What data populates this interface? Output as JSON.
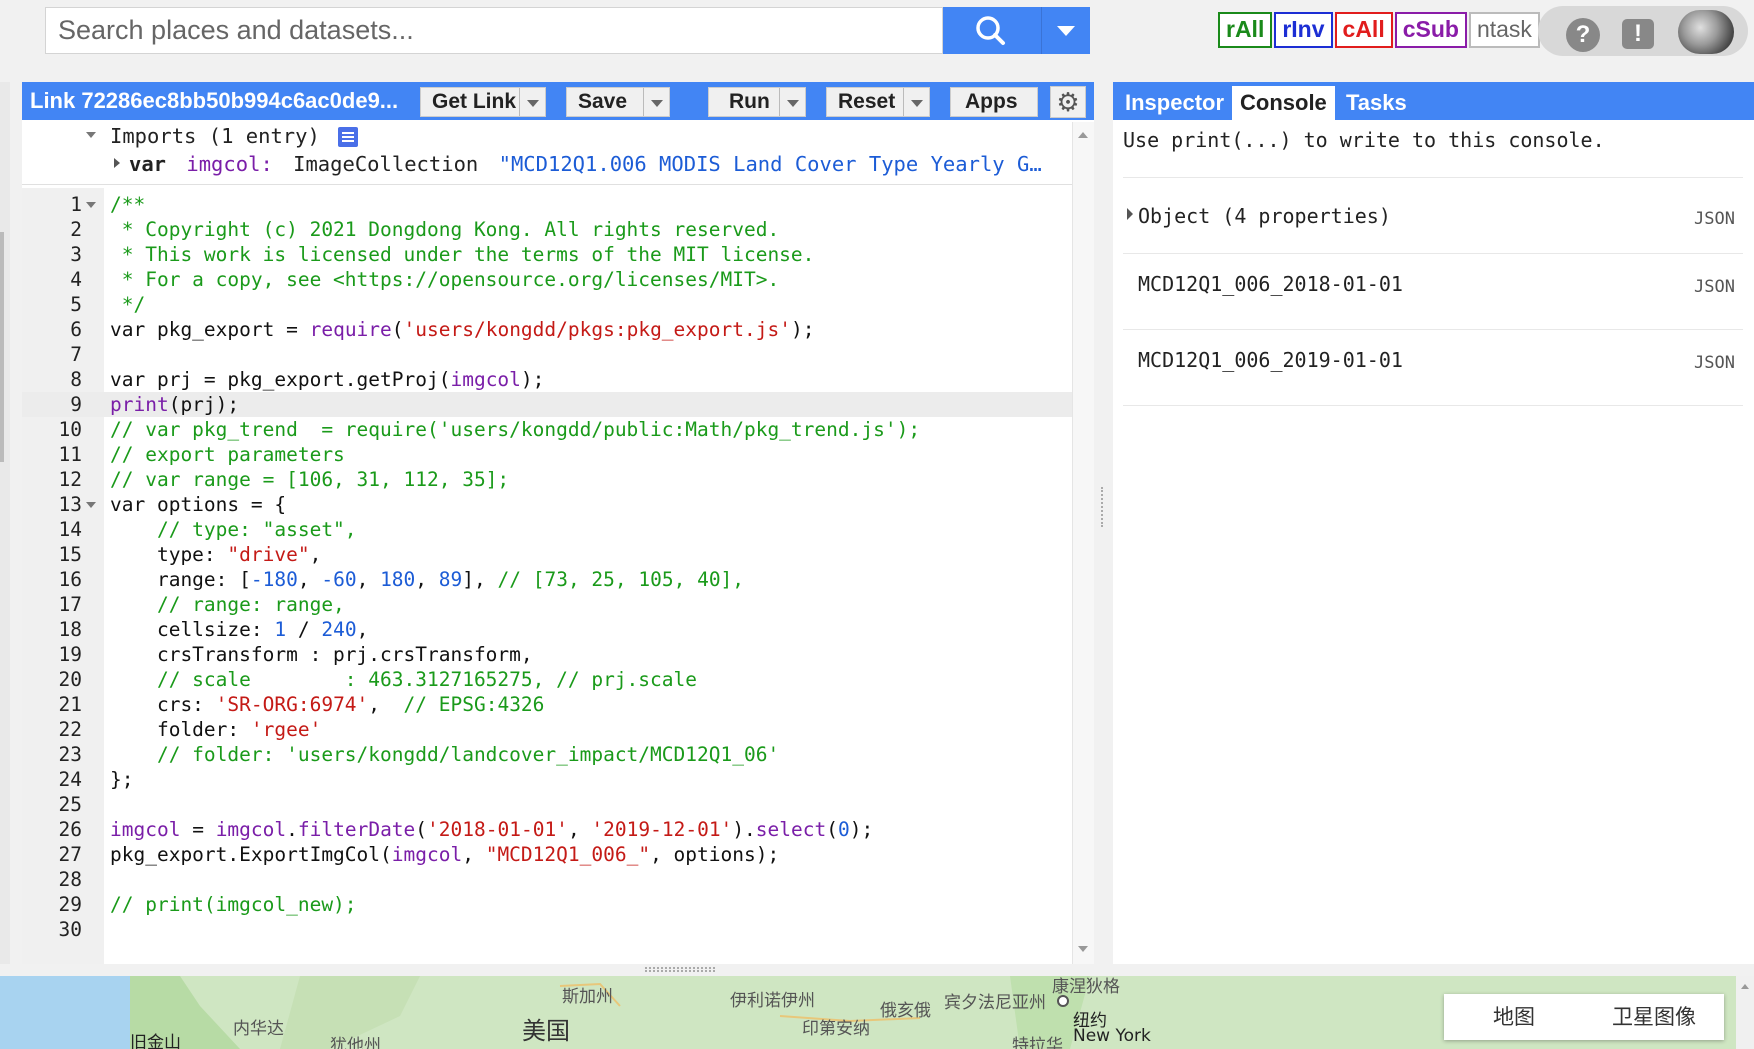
{
  "search": {
    "placeholder": "Search places and datasets..."
  },
  "extensions": [
    "rAll",
    "rInv",
    "cAll",
    "cSub",
    "ntask"
  ],
  "header_icons": [
    "help-icon",
    "feedback-icon"
  ],
  "editor": {
    "script_title": "Link 72286ec8bb50b994c6ac0de9...",
    "buttons": {
      "get_link": "Get Link",
      "save": "Save",
      "run": "Run",
      "reset": "Reset",
      "apps": "Apps"
    },
    "imports": {
      "header": "Imports (1 entry)",
      "entry_kw": "var",
      "entry_name": "imgcol",
      "entry_type": "ImageCollection",
      "entry_desc": "\"MCD12Q1.006 MODIS Land Cover Type Yearly G…"
    },
    "active_line": 9,
    "lines": [
      {
        "n": "1",
        "fold": true,
        "text": "/**"
      },
      {
        "n": "2",
        "text": " * Copyright (c) 2021 Dongdong Kong. All rights reserved."
      },
      {
        "n": "3",
        "text": " * This work is licensed under the terms of the MIT license."
      },
      {
        "n": "4",
        "text": " * For a copy, see <https://opensource.org/licenses/MIT>."
      },
      {
        "n": "5",
        "text": " */"
      },
      {
        "n": "6",
        "text": "var pkg_export = require('users/kongdd/pkgs:pkg_export.js');"
      },
      {
        "n": "7",
        "text": ""
      },
      {
        "n": "8",
        "text": "var prj = pkg_export.getProj(imgcol);"
      },
      {
        "n": "9",
        "text": "print(prj);"
      },
      {
        "n": "10",
        "text": "// var pkg_trend  = require('users/kongdd/public:Math/pkg_trend.js');"
      },
      {
        "n": "11",
        "text": "// export parameters"
      },
      {
        "n": "12",
        "text": "// var range = [106, 31, 112, 35];"
      },
      {
        "n": "13",
        "fold": true,
        "text": "var options = {"
      },
      {
        "n": "14",
        "text": "    // type: \"asset\","
      },
      {
        "n": "15",
        "text": "    type: \"drive\","
      },
      {
        "n": "16",
        "text": "    range: [-180, -60, 180, 89], // [73, 25, 105, 40],"
      },
      {
        "n": "17",
        "text": "    // range: range,"
      },
      {
        "n": "18",
        "text": "    cellsize: 1 / 240,"
      },
      {
        "n": "19",
        "text": "    crsTransform : prj.crsTransform,"
      },
      {
        "n": "20",
        "text": "    // scale        : 463.3127165275, // prj.scale"
      },
      {
        "n": "21",
        "text": "    crs: 'SR-ORG:6974',  // EPSG:4326"
      },
      {
        "n": "22",
        "text": "    folder: 'rgee'"
      },
      {
        "n": "23",
        "text": "    // folder: 'users/kongdd/landcover_impact/MCD12Q1_06'"
      },
      {
        "n": "24",
        "text": "};"
      },
      {
        "n": "25",
        "text": ""
      },
      {
        "n": "26",
        "text": "imgcol = imgcol.filterDate('2018-01-01', '2019-12-01').select(0);"
      },
      {
        "n": "27",
        "text": "pkg_export.ExportImgCol(imgcol, \"MCD12Q1_006_\", options);"
      },
      {
        "n": "28",
        "text": ""
      },
      {
        "n": "29",
        "text": "// print(imgcol_new);"
      },
      {
        "n": "30",
        "text": ""
      }
    ]
  },
  "right_panel": {
    "tabs": [
      "Inspector",
      "Console",
      "Tasks"
    ],
    "active_tab": "Console",
    "console_hint": "Use print(...) to write to this console.",
    "rows": [
      {
        "text": "Object (4 properties)",
        "expandable": true,
        "tag": "JSON"
      },
      {
        "text": "MCD12Q1_006_2018-01-01",
        "expandable": false,
        "tag": "JSON"
      },
      {
        "text": "MCD12Q1_006_2019-01-01",
        "expandable": false,
        "tag": "JSON"
      }
    ]
  },
  "map": {
    "labels": [
      "旧金山",
      "内华达",
      "犹他州",
      "斯加州",
      "美国",
      "伊利诺伊州",
      "印第安纳",
      "俄亥俄",
      "宾夕法尼亚州",
      "纽约",
      "New York",
      "康涅狄格",
      "特拉华"
    ],
    "toggle": [
      "地图",
      "卫星图像"
    ]
  },
  "colors": {
    "accent": "#4285f4",
    "comment": "#1a9a1a",
    "string": "#c41a16",
    "number": "#1c5cd6",
    "identifier": "#7a1ea8"
  }
}
